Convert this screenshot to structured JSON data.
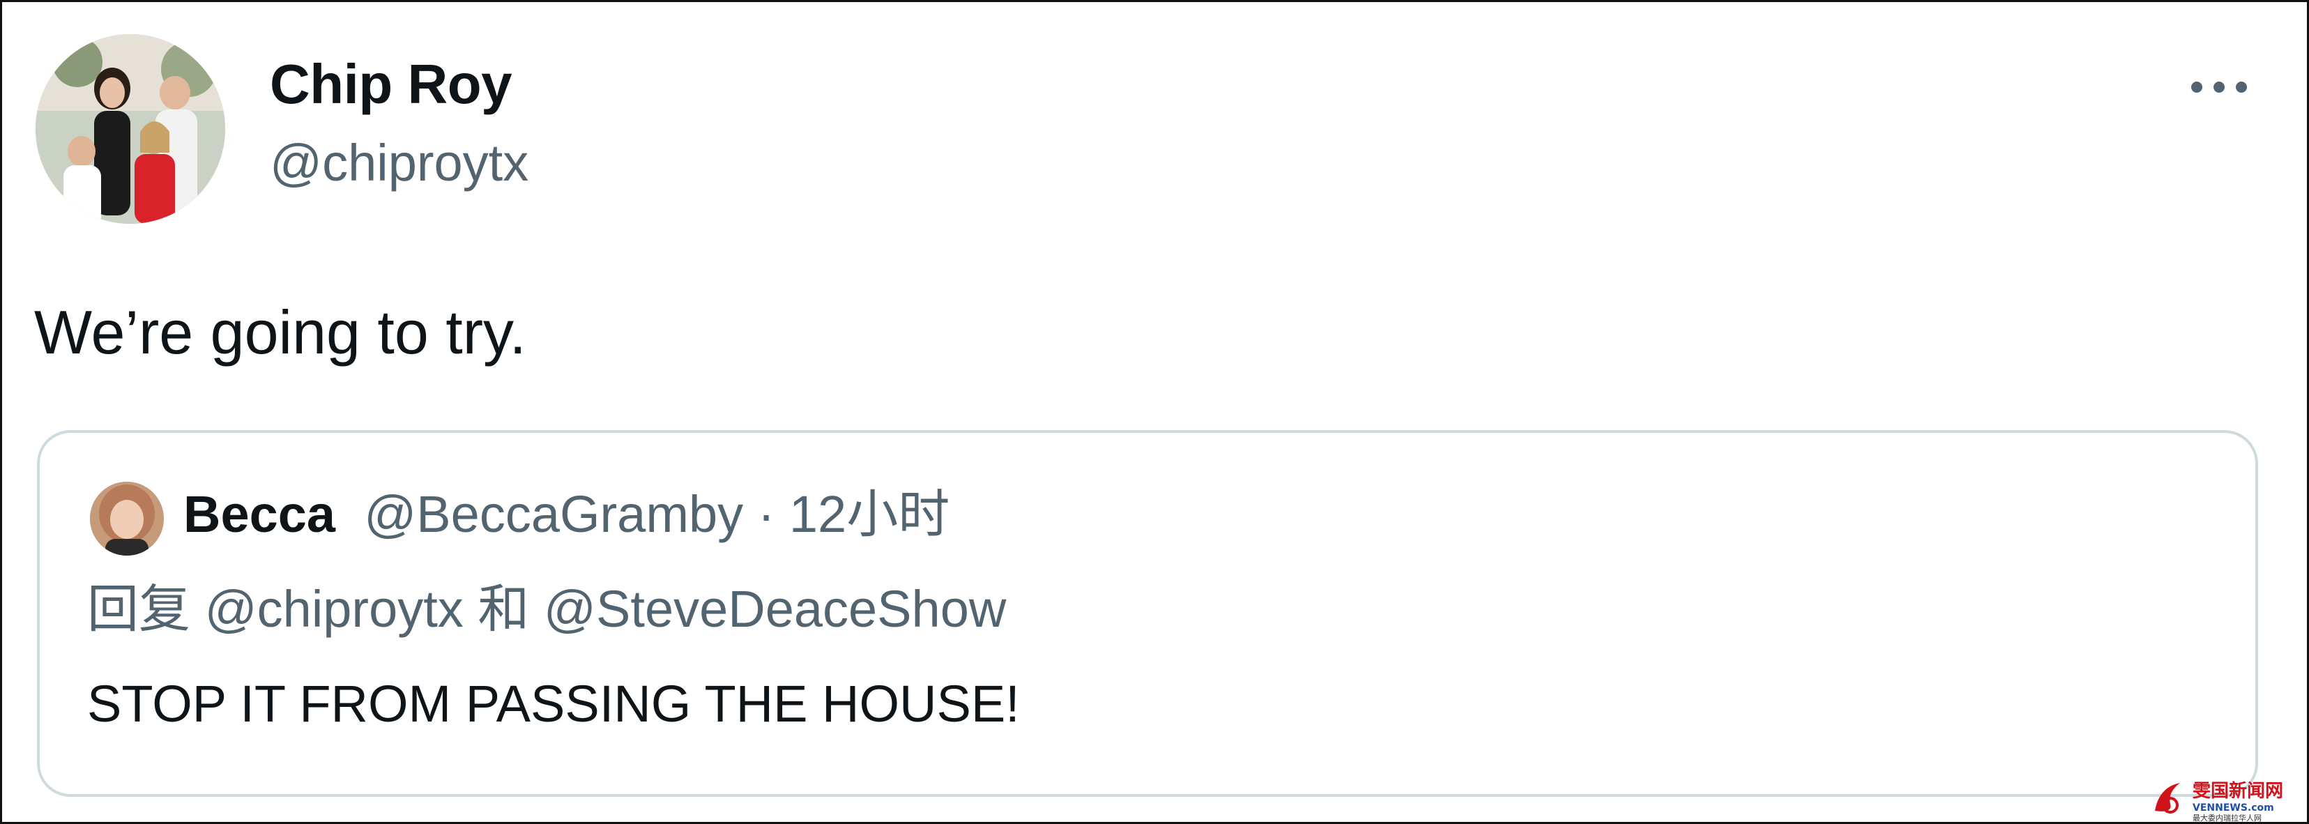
{
  "tweet": {
    "author_name": "Chip Roy",
    "author_handle": "@chiproytx",
    "text": "We’re going to try.",
    "more_icon": "more-horizontal-icon"
  },
  "quoted_tweet": {
    "author_name": "Becca",
    "author_handle": "@BeccaGramby",
    "separator": " · ",
    "time": "12小时",
    "reply_prefix": "回复",
    "reply_mention_1": "@chiproytx",
    "reply_joiner": "和",
    "reply_mention_2": "@SteveDeaceShow",
    "text": "STOP IT FROM PASSING THE HOUSE!"
  },
  "watermark": {
    "title": "雯国新闻网",
    "site": "VENNEWS.com",
    "tagline": "最大委内瑞拉华人网"
  },
  "colors": {
    "primary_text": "#0f1419",
    "secondary_text": "#536471",
    "card_border": "#cfd9de",
    "watermark_red": "#d0121b"
  }
}
